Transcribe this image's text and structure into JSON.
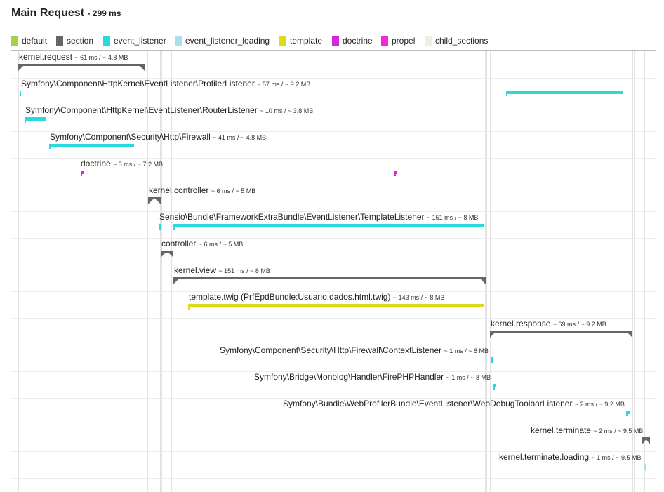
{
  "header": {
    "title": "Main Request",
    "duration": "- 299 ms"
  },
  "legend": [
    {
      "label": "default",
      "color": "#a6d144"
    },
    {
      "label": "section",
      "color": "#666666"
    },
    {
      "label": "event_listener",
      "color": "#29d9dc"
    },
    {
      "label": "event_listener_loading",
      "color": "#a9dfe5"
    },
    {
      "label": "template",
      "color": "#dbdb1a"
    },
    {
      "label": "doctrine",
      "color": "#d228d6"
    },
    {
      "label": "propel",
      "color": "#f12bd0"
    },
    {
      "label": "child_sections",
      "color": "#efefe3"
    }
  ],
  "chart_data": {
    "type": "timeline",
    "total_ms": 299,
    "events": [
      {
        "name": "kernel.request",
        "meta": "~ 61 ms / ~ 4.8 MB",
        "category": "section"
      },
      {
        "name": "Symfony\\Component\\HttpKernel\\EventListener\\ProfilerListener",
        "meta": "~ 57 ms / ~ 9.2 MB",
        "category": "event_listener"
      },
      {
        "name": "Symfony\\Component\\HttpKernel\\EventListener\\RouterListener",
        "meta": "~ 10 ms / ~ 3.8 MB",
        "category": "event_listener"
      },
      {
        "name": "Symfony\\Component\\Security\\Http\\Firewall",
        "meta": "~ 41 ms / ~ 4.8 MB",
        "category": "event_listener"
      },
      {
        "name": "doctrine",
        "meta": "~ 3 ms / ~ 7.2 MB",
        "category": "doctrine"
      },
      {
        "name": "kernel.controller",
        "meta": "~ 6 ms / ~ 5 MB",
        "category": "section"
      },
      {
        "name": "Sensio\\Bundle\\FrameworkExtraBundle\\EventListener\\TemplateListener",
        "meta": "~ 151 ms / ~ 8 MB",
        "category": "event_listener"
      },
      {
        "name": "controller",
        "meta": "~ 6 ms / ~ 5 MB",
        "category": "section"
      },
      {
        "name": "kernel.view",
        "meta": "~ 151 ms / ~ 8 MB",
        "category": "section"
      },
      {
        "name": "template.twig (PrfEpdBundle:Usuario:dados.html.twig)",
        "meta": "~ 143 ms / ~ 8 MB",
        "category": "template"
      },
      {
        "name": "kernel.response",
        "meta": "~ 69 ms / ~ 9.2 MB",
        "category": "section"
      },
      {
        "name": "Symfony\\Component\\Security\\Http\\Firewall\\ContextListener",
        "meta": "~ 1 ms / ~ 8 MB",
        "category": "event_listener"
      },
      {
        "name": "Symfony\\Bridge\\Monolog\\Handler\\FirePHPHandler",
        "meta": "~ 1 ms / ~ 8 MB",
        "category": "event_listener"
      },
      {
        "name": "Symfony\\Bundle\\WebProfilerBundle\\EventListener\\WebDebugToolbarListener",
        "meta": "~ 2 ms / ~ 9.2 MB",
        "category": "event_listener"
      },
      {
        "name": "kernel.terminate",
        "meta": "~ 2 ms / ~ 9.5 MB",
        "category": "section"
      },
      {
        "name": "kernel.terminate.loading",
        "meta": "~ 1 ms / ~ 9.5 MB",
        "category": "event_listener_loading"
      }
    ]
  }
}
